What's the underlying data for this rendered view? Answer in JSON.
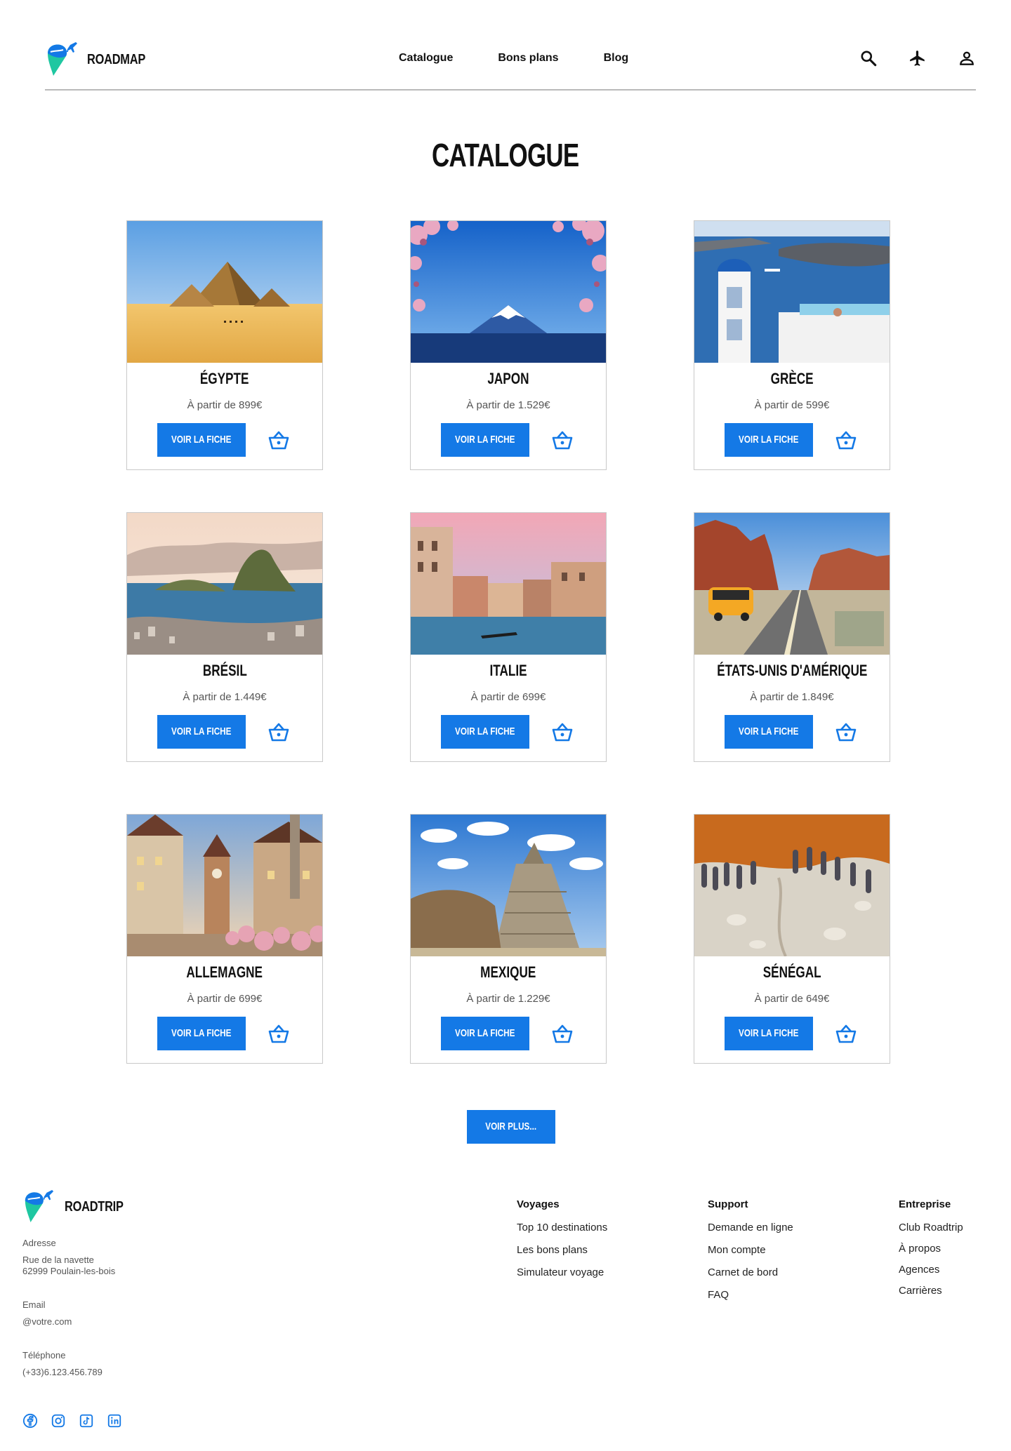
{
  "header": {
    "brand": "ROADMAP",
    "nav": [
      {
        "label": "Catalogue"
      },
      {
        "label": "Bons plans"
      },
      {
        "label": "Blog"
      }
    ]
  },
  "page": {
    "title": "CATALOGUE"
  },
  "catalogue": {
    "button_label": "VOIR LA FICHE",
    "items": [
      {
        "name": "ÉGYPTE",
        "price": "À partir de 899€"
      },
      {
        "name": "JAPON",
        "price": "À partir de 1.529€"
      },
      {
        "name": "GRÈCE",
        "price": "À partir de 599€"
      },
      {
        "name": "BRÉSIL",
        "price": "À partir de 1.449€"
      },
      {
        "name": "ITALIE",
        "price": "À partir de 699€"
      },
      {
        "name": "ÉTATS-UNIS D'AMÉRIQUE",
        "price": "À partir de 1.849€"
      },
      {
        "name": "ALLEMAGNE",
        "price": "À partir de 699€"
      },
      {
        "name": "MEXIQUE",
        "price": "À partir de 1.229€"
      },
      {
        "name": "SÉNÉGAL",
        "price": "À partir de 649€"
      }
    ],
    "more_label": "VOIR PLUS..."
  },
  "footer": {
    "brand": "ROADTRIP",
    "address_label": "Adresse",
    "address_line1": "Rue de la navette",
    "address_line2": "62999 Poulain-les-bois",
    "email_label": "Email",
    "email": "@votre.com",
    "phone_label": "Téléphone",
    "phone": "(+33)6.123.456.789",
    "columns": [
      {
        "title": "Voyages",
        "links": [
          "Top 10 destinations",
          "Les bons plans",
          "Simulateur voyage"
        ]
      },
      {
        "title": "Support",
        "links": [
          "Demande en ligne",
          "Mon compte",
          "Carnet de bord",
          "FAQ"
        ]
      },
      {
        "title": "Entreprise",
        "links": [
          "Club Roadtrip",
          "À propos",
          "Agences",
          "Carrières"
        ]
      }
    ],
    "social_icons": [
      "facebook-icon",
      "instagram-icon",
      "tiktok-icon",
      "linkedin-icon"
    ]
  },
  "colors": {
    "accent": "#1479e6",
    "logo_blue": "#1479e6",
    "logo_teal": "#1fc7a1",
    "divider": "#b9b9b9"
  }
}
